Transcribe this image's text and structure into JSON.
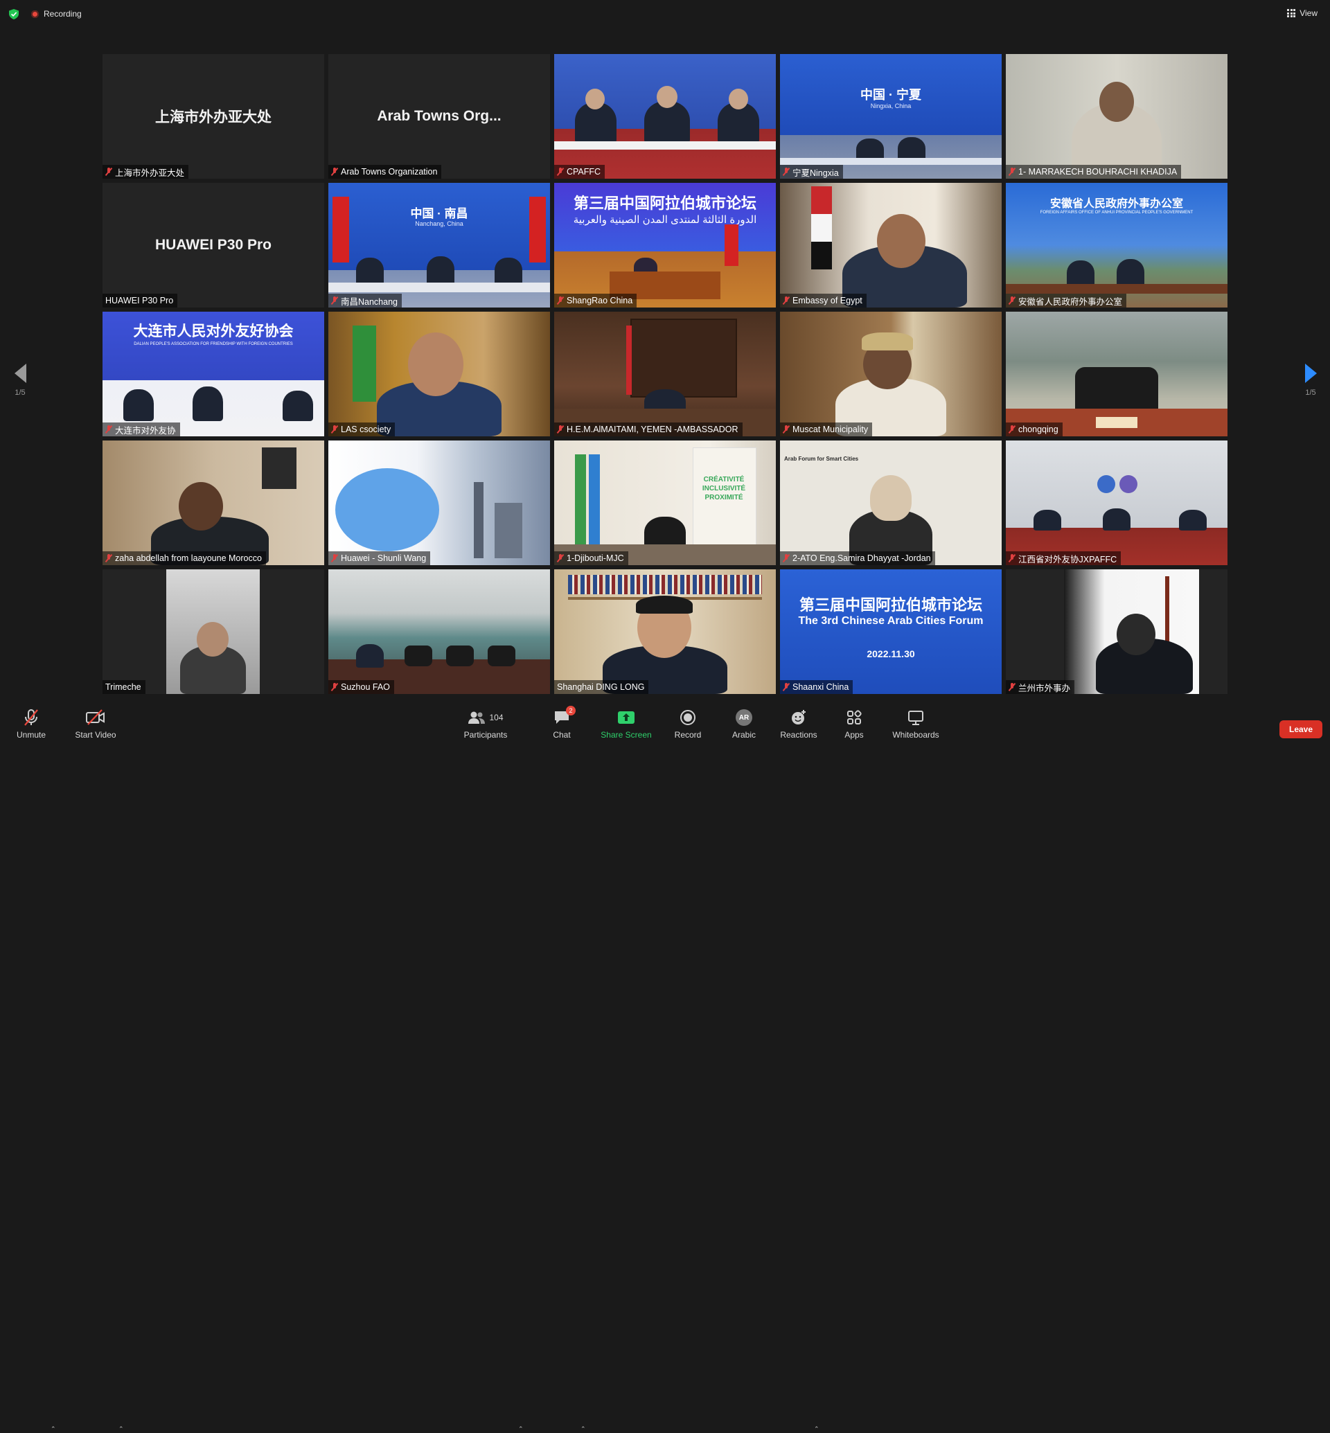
{
  "topbar": {
    "recording_label": "Recording",
    "view_label": "View"
  },
  "pager": {
    "left_count": "1/5",
    "right_count": "1/5"
  },
  "tiles": [
    {
      "name": "上海市外办亚大处",
      "big": "上海市外办亚大处",
      "muted": true
    },
    {
      "name": "Arab Towns Organization",
      "big": "Arab Towns Org...",
      "muted": true
    },
    {
      "name": "CPAFFC",
      "muted": true
    },
    {
      "name": "宁夏Ningxia",
      "muted": true,
      "banner": "中国 · 宁夏",
      "banner_sub": "Ningxia, China"
    },
    {
      "name": "1- MARRAKECH BOUHRACHI KHADIJA",
      "muted": true
    },
    {
      "name": "HUAWEI P30 Pro",
      "big": "HUAWEI P30 Pro",
      "muted": false
    },
    {
      "name": "南昌Nanchang",
      "muted": true,
      "banner": "中国 · 南昌",
      "banner_sub": "Nanchang, China"
    },
    {
      "name": "ShangRao China",
      "muted": true,
      "banner": "第三届中国阿拉伯城市论坛",
      "banner_sub": "الدورة الثالثة لمنتدى المدن الصينية والعربية"
    },
    {
      "name": "Embassy of Egypt",
      "muted": true
    },
    {
      "name": "安徽省人民政府外事办公室",
      "muted": true,
      "banner": "安徽省人民政府外事办公室",
      "banner_sub": "FOREIGN AFFAIRS OFFICE OF ANHUI PROVINCIAL PEOPLE'S GOVERNMENT"
    },
    {
      "name": "大连市对外友协",
      "muted": true,
      "banner": "大连市人民对外友好协会",
      "banner_sub": "DALIAN PEOPLE'S ASSOCIATION FOR FRIENDSHIP WITH FOREIGN COUNTRIES"
    },
    {
      "name": "LAS csociety",
      "muted": true
    },
    {
      "name": "H.E.M.AlMAITAMI, YEMEN -AMBASSADOR",
      "muted": true
    },
    {
      "name": "Muscat Municipality",
      "muted": true
    },
    {
      "name": "chongqing",
      "muted": true
    },
    {
      "name": "zaha abdellah from laayoune Morocco",
      "muted": true
    },
    {
      "name": "Huawei - Shunli Wang",
      "muted": true
    },
    {
      "name": "1-Djibouti-MJC",
      "muted": true,
      "banner": "CRÉATIVITÉ INCLUSIVITÉ PROXIMITÉ"
    },
    {
      "name": "2-ATO Eng.Samira Dhayyat -Jordan",
      "muted": true,
      "banner": "Arab Forum for Smart Cities"
    },
    {
      "name": "江西省对外友协JXPAFFC",
      "muted": true
    },
    {
      "name": "Trimeche",
      "muted": false
    },
    {
      "name": "Suzhou FAO",
      "muted": true
    },
    {
      "name": "Shanghai DING LONG",
      "muted": false
    },
    {
      "name": "Shaanxi China",
      "muted": true,
      "banner": "第三届中国阿拉伯城市论坛",
      "banner_sub": "The 3rd Chinese Arab Cities Forum",
      "banner_date": "2022.11.30"
    },
    {
      "name": "兰州市外事办",
      "muted": true
    }
  ],
  "toolbar": {
    "unmute": "Unmute",
    "start_video": "Start Video",
    "participants": "Participants",
    "participants_count": "104",
    "chat": "Chat",
    "chat_badge": "2",
    "share_screen": "Share Screen",
    "record": "Record",
    "interpretation": "Arabic",
    "interpretation_avatar": "AR",
    "reactions": "Reactions",
    "apps": "Apps",
    "whiteboards": "Whiteboards",
    "leave": "Leave"
  },
  "colors": {
    "leave_red": "#d93025",
    "share_green": "#2fd06b",
    "active_speaker": "#d7e87a",
    "pager_blue": "#2d8cff"
  }
}
